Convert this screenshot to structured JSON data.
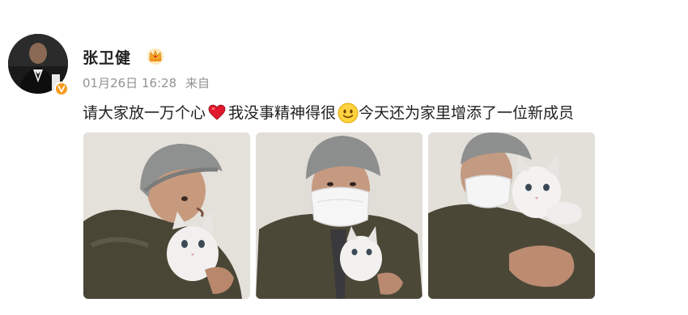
{
  "post": {
    "author": "张卫健",
    "author_badge_icon": "crown-icon",
    "verified_icon": "verified-v-icon",
    "timestamp": "01月26日 16:28",
    "source": "来自",
    "text_part1": "请大家放一万个心",
    "emoji1": "heart-emoji",
    "text_part2": "我没事精神得很",
    "emoji2": "smile-emoji",
    "text_part3": "今天还为家里增添了一位新成员",
    "photo_count": 3
  },
  "colors": {
    "verified": "#f79b1c",
    "meta_text": "#939393",
    "heart": "#e0182d"
  }
}
